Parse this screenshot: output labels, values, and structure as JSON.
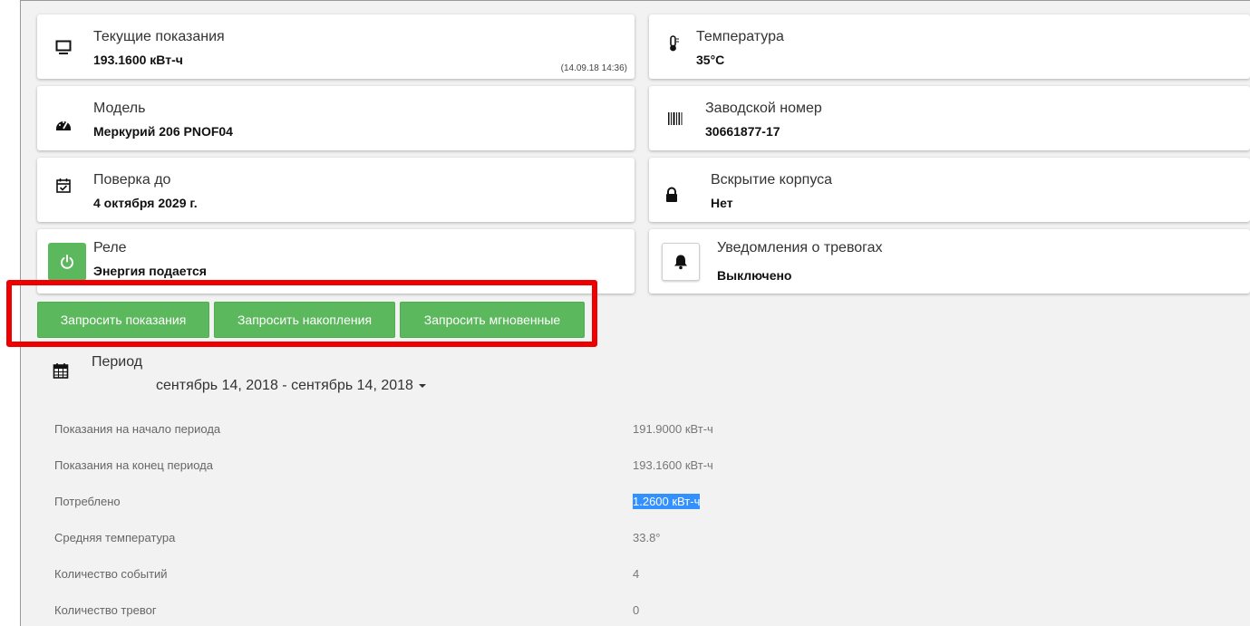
{
  "cards": {
    "current_reading": {
      "label": "Текущие показания",
      "value": "193.1600 кВт-ч",
      "timestamp": "(14.09.18 14:36)",
      "icon": "monitor-icon"
    },
    "temperature": {
      "label": "Температура",
      "value": "35°C",
      "icon": "thermometer-icon"
    },
    "model": {
      "label": "Модель",
      "value": "Меркурий 206 PNOF04",
      "icon": "gauge-icon"
    },
    "serial": {
      "label": "Заводской номер",
      "value": "30661877-17",
      "icon": "barcode-icon"
    },
    "verification": {
      "label": "Поверка до",
      "value": "4 октября 2029 г.",
      "icon": "calendar-check-icon"
    },
    "case_opening": {
      "label": "Вскрытие корпуса",
      "value": "Нет",
      "icon": "lock-icon"
    },
    "relay": {
      "label": "Реле",
      "value": "Энергия подается",
      "icon": "power-icon"
    },
    "alarm_notifications": {
      "label": "Уведомления о тревогах",
      "value": "Выключено",
      "icon": "bell-icon"
    }
  },
  "actions": {
    "request_readings": "Запросить показания",
    "request_accumulations": "Запросить накопления",
    "request_instant": "Запросить мгновенные"
  },
  "period": {
    "label": "Период",
    "range": "сентябрь 14, 2018 - сентябрь 14, 2018",
    "icon": "calendar-icon"
  },
  "stats": [
    {
      "label": "Показания на начало периода",
      "value": "191.9000 кВт-ч"
    },
    {
      "label": "Показания на конец периода",
      "value": "193.1600 кВт-ч"
    },
    {
      "label": "Потреблено",
      "value": "1.2600 кВт-ч"
    },
    {
      "label": "Средняя температура",
      "value": "33.8°"
    },
    {
      "label": "Количество событий",
      "value": "4"
    },
    {
      "label": "Количество тревог",
      "value": "0"
    }
  ],
  "colors": {
    "accent_green": "#5cb85c",
    "highlight_red": "#ee0000",
    "selection_blue": "#3390ff"
  }
}
